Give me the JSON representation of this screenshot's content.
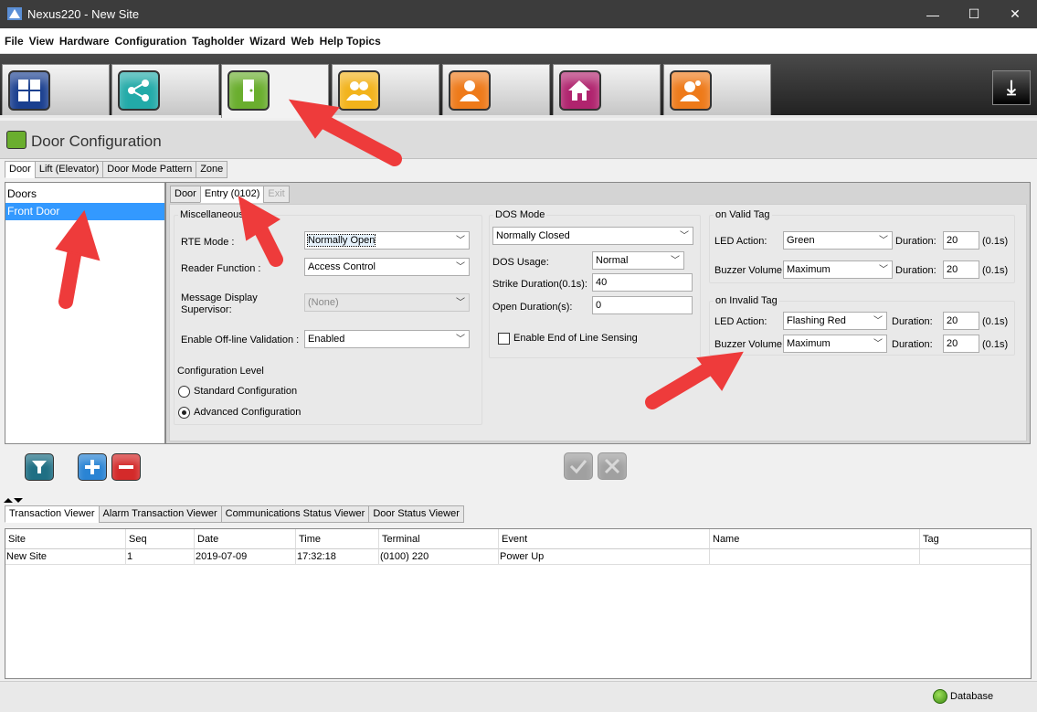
{
  "window": {
    "title": "Nexus220 - New Site",
    "minimize": "—",
    "maximize": "☐",
    "close": "✕"
  },
  "menu": [
    "File",
    "View",
    "Hardware",
    "Configuration",
    "Tagholder",
    "Wizard",
    "Web",
    "Help Topics"
  ],
  "modules": [
    {
      "icon": "dashboard-grid-icon",
      "color": "#1a3f8f"
    },
    {
      "icon": "network-nodes-icon",
      "color": "#22aaa8"
    },
    {
      "icon": "door-icon",
      "color": "#6aae2e",
      "active": true
    },
    {
      "icon": "user-group-icon",
      "color": "#f2b31b"
    },
    {
      "icon": "user-icon",
      "color": "#ee7a1a"
    },
    {
      "icon": "house-key-icon",
      "color": "#b0246e"
    },
    {
      "icon": "user-alert-icon",
      "color": "#ee7a1a"
    }
  ],
  "page": {
    "title": "Door Configuration"
  },
  "left_tabs": [
    "Door",
    "Lift (Elevator)",
    "Door Mode Pattern",
    "Zone"
  ],
  "door_list": {
    "header": "Doors",
    "items": [
      "Front Door"
    ]
  },
  "inner_tabs": [
    "Door",
    "Entry (0102)",
    "Exit"
  ],
  "misc": {
    "legend": "Miscellaneous",
    "rte_label": "RTE Mode :",
    "rte_value": "Normally Open",
    "reader_label": "Reader Function :",
    "reader_value": "Access Control",
    "msg_label": "Message Display Supervisor:",
    "msg_value": "(None)",
    "offline_label": "Enable Off-line Validation :",
    "offline_value": "Enabled",
    "config_level_label": "Configuration Level",
    "standard": "Standard Configuration",
    "advanced": "Advanced Configuration"
  },
  "dos": {
    "legend": "DOS Mode",
    "mode_value": "Normally Closed",
    "usage_label": "DOS Usage:",
    "usage_value": "Normal",
    "strike_label": "Strike Duration(0.1s):",
    "strike_value": "40",
    "open_label": "Open Duration(s):",
    "open_value": "0",
    "eol_label": "Enable End of Line Sensing"
  },
  "valid_tag": {
    "legend": "on Valid Tag",
    "led_label": "LED Action:",
    "led_value": "Green",
    "buzzer_label": "Buzzer Volume:",
    "buzzer_value": "Maximum",
    "duration_label": "Duration:",
    "led_duration": "20",
    "buzzer_duration": "20",
    "unit": "(0.1s)"
  },
  "invalid_tag": {
    "legend": "on Invalid Tag",
    "led_label": "LED Action:",
    "led_value": "Flashing Red",
    "buzzer_label": "Buzzer Volume:",
    "buzzer_value": "Maximum",
    "duration_label": "Duration:",
    "led_duration": "20",
    "buzzer_duration": "20",
    "unit": "(0.1s)"
  },
  "bottom_tabs": [
    "Transaction Viewer",
    "Alarm Transaction Viewer",
    "Communications Status Viewer",
    "Door Status Viewer"
  ],
  "grid": {
    "columns": [
      "Site",
      "Seq",
      "Date",
      "Time",
      "Terminal",
      "Event",
      "Name",
      "Tag"
    ],
    "rows": [
      [
        "New Site",
        "1",
        "2019-07-09",
        "17:32:18",
        "(0100) 220",
        "Power Up",
        "",
        ""
      ]
    ]
  },
  "status": {
    "database": "Database"
  }
}
